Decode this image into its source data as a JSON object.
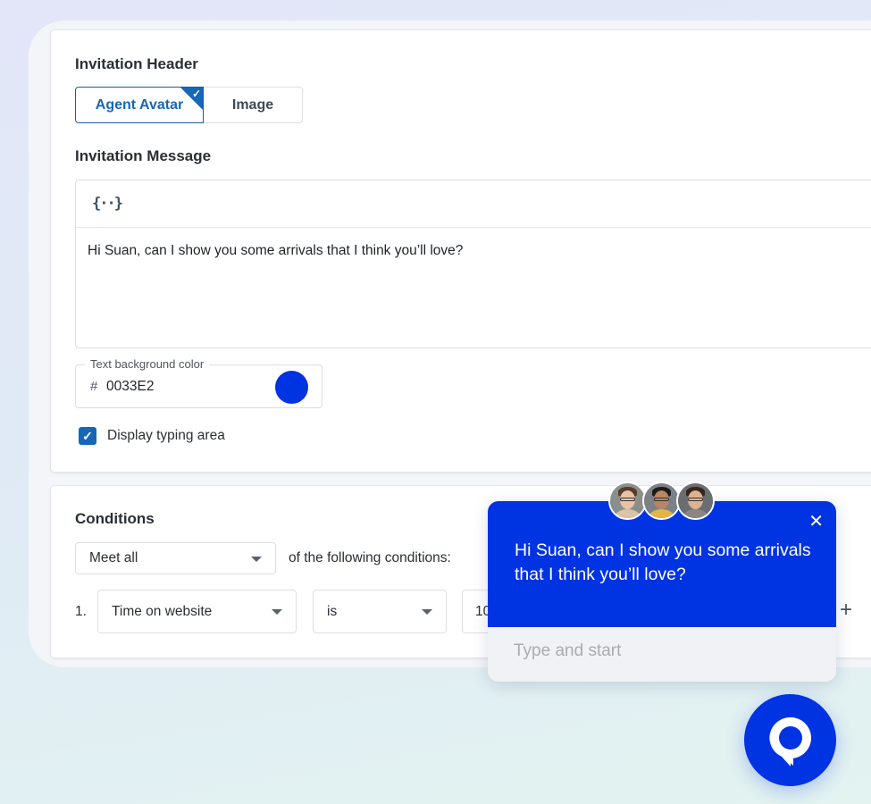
{
  "invitation_header": {
    "title": "Invitation Header",
    "options": [
      {
        "label": "Agent Avatar",
        "selected": true
      },
      {
        "label": "Image",
        "selected": false
      }
    ]
  },
  "invitation_message": {
    "title": "Invitation Message",
    "toolbar_icon": "variable-braces-icon",
    "toolbar_glyph": "{··}",
    "text": "Hi Suan, can I show you some arrivals that I think you’ll love?"
  },
  "text_background_color": {
    "label": "Text background color",
    "hash": "#",
    "value": "0033E2",
    "swatch": "#0033E2"
  },
  "display_typing_area": {
    "label": "Display typing area",
    "checked": true,
    "check_glyph": "✓"
  },
  "conditions": {
    "title": "Conditions",
    "match_select": "Meet all",
    "match_suffix": "of the following conditions:",
    "rows": [
      {
        "index": "1.",
        "field": "Time on website",
        "operator": "is",
        "value": "10"
      }
    ],
    "add_glyph": "+"
  },
  "chat_preview": {
    "message": "Hi Suan, can I show you some arrivals that I think you’ll love?",
    "close_glyph": "✕",
    "input_placeholder": "Type and start",
    "accent": "#0033E2"
  },
  "selected_corner_check": "✓"
}
